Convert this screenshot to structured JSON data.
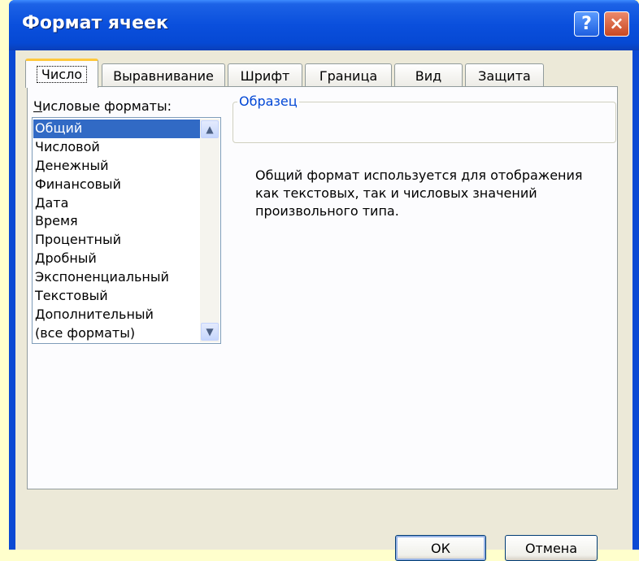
{
  "window": {
    "title": "Формат ячеек"
  },
  "caption": {
    "help": "?",
    "close": "×"
  },
  "tabs": [
    {
      "label": "Число"
    },
    {
      "label": "Выравнивание"
    },
    {
      "label": "Шрифт"
    },
    {
      "label": "Граница"
    },
    {
      "label": "Вид"
    },
    {
      "label": "Защита"
    }
  ],
  "number_tab": {
    "formats_label_hotkey": "Ч",
    "formats_label_rest": "исловые форматы:",
    "formats": [
      "Общий",
      "Числовой",
      "Денежный",
      "Финансовый",
      "Дата",
      "Время",
      "Процентный",
      "Дробный",
      "Экспоненциальный",
      "Текстовый",
      "Дополнительный",
      "(все форматы)"
    ],
    "selected_format": "Общий",
    "sample_label": "Образец",
    "description": "Общий формат используется для отображения как текстовых, так и числовых значений произвольного типа."
  },
  "buttons": {
    "ok": "ОК",
    "cancel": "Отмена"
  },
  "colors": {
    "title_bar": "#0A4FDC",
    "selection": "#316AC5",
    "tab_highlight": "#FFC83C",
    "background": "#FFFFCC"
  },
  "icons": {
    "help": "help-icon",
    "close": "close-icon",
    "scroll_up": "chevron-up-icon",
    "scroll_down": "chevron-down-icon"
  }
}
